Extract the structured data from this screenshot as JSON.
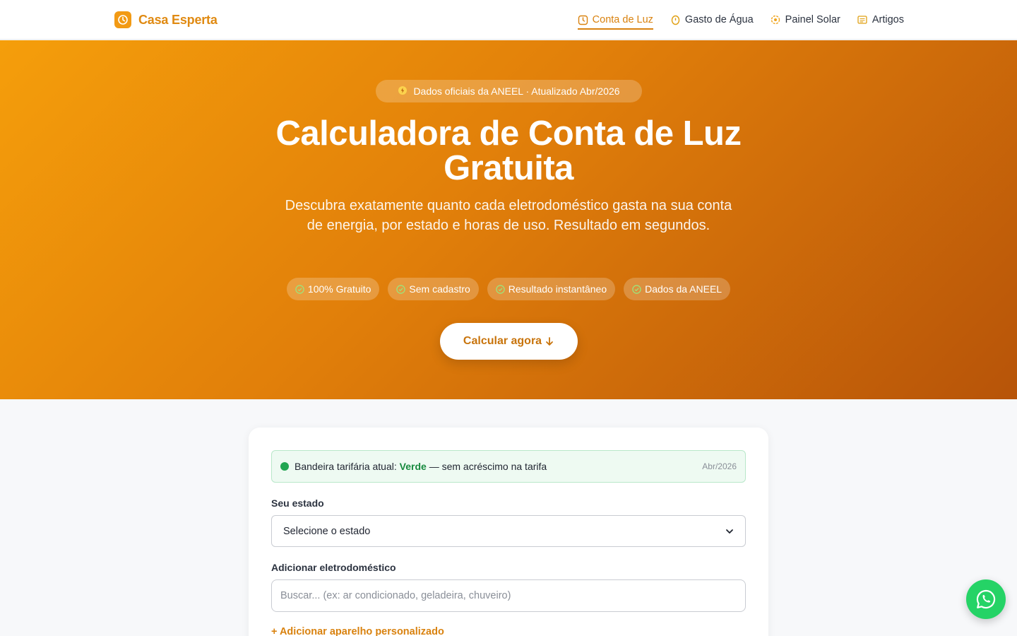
{
  "header": {
    "brand": "Casa Esperta",
    "nav": [
      {
        "label": "Conta de Luz",
        "icon": "lightbulb-icon",
        "active": true
      },
      {
        "label": "Gasto de Água",
        "icon": "water-drop-icon",
        "active": false
      },
      {
        "label": "Painel Solar",
        "icon": "sun-icon",
        "active": false
      },
      {
        "label": "Artigos",
        "icon": "document-icon",
        "active": false
      }
    ]
  },
  "hero": {
    "badge": "Dados oficiais da ANEEL · Atualizado Abr/2026",
    "title": "Calculadora de Conta de Luz Gratuita",
    "subtitle": "Descubra exatamente quanto cada eletrodoméstico gasta na sua conta de energia, por estado e horas de uso. Resultado em segundos.",
    "pills": [
      "100% Gratuito",
      "Sem cadastro",
      "Resultado instantâneo",
      "Dados da ANEEL"
    ],
    "cta": "Calcular agora"
  },
  "calculator": {
    "flag": {
      "prefix": "Bandeira tarifária atual:",
      "value": "Verde",
      "suffix": "— sem acréscimo na tarifa",
      "date": "Abr/2026"
    },
    "state_label": "Seu estado",
    "state_value": "Selecione o estado",
    "appliance_label": "Adicionar eletrodoméstico",
    "search_placeholder": "Buscar... (ex: ar condicionado, geladeira, chuveiro)",
    "add_custom": "+ Adicionar aparelho personalizado"
  },
  "colors": {
    "brand": "#f29a14",
    "hero_start": "#f59e0b",
    "hero_end": "#b75409",
    "flag_green": "#22a652",
    "whatsapp": "#25d366"
  }
}
